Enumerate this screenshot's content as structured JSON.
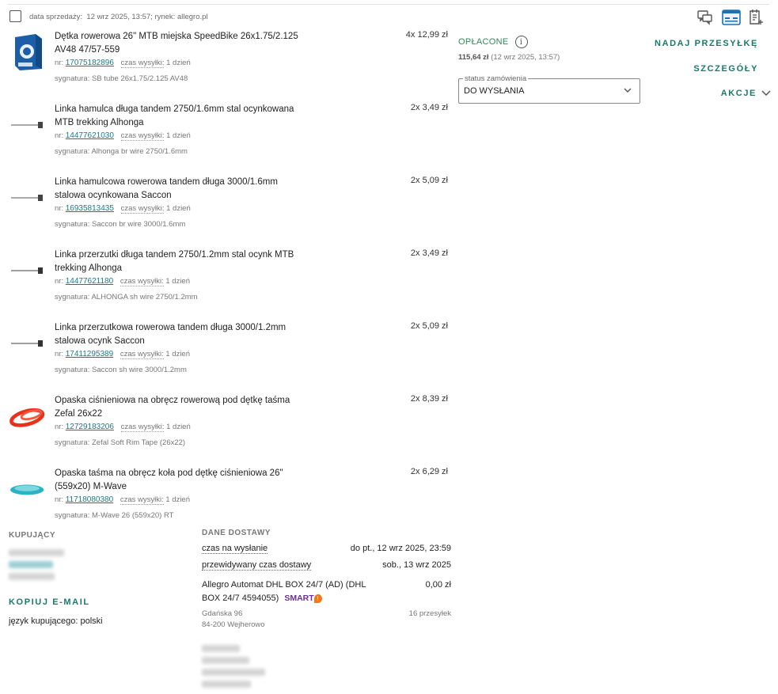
{
  "header": {
    "sale_date_label": "data sprzedaży:",
    "sale_date_value": "12 wrz 2025, 13:57; rynek: allegro.pl",
    "icons": [
      "chat-icon",
      "invoice-icon",
      "notes-icon"
    ]
  },
  "items": [
    {
      "name": "Dętka rowerowa 26\" MTB miejska SpeedBike 26x1.75/2.125 AV48 47/57-559",
      "price": "4x 12,99 zł",
      "nr_label": "nr:",
      "nr": "17075182896",
      "ship_label": "czas wysyłki:",
      "ship_value": "1 dzień",
      "sig": "sygnatura: SB tube 26x1.75/2.125 AV48",
      "thumb": "box-blue"
    },
    {
      "name": "Linka hamulca długa tandem 2750/1.6mm stal ocynkowana MTB trekking Alhonga",
      "price": "2x 3,49 zł",
      "nr_label": "nr:",
      "nr": "14477621030",
      "ship_label": "czas wysyłki:",
      "ship_value": "1 dzień",
      "sig": "sygnatura: Alhonga br wire 2750/1.6mm",
      "thumb": "cable"
    },
    {
      "name": "Linka hamulcowa rowerowa tandem długa 3000/1.6mm stalowa ocynkowana Saccon",
      "price": "2x 5,09 zł",
      "nr_label": "nr:",
      "nr": "16935813435",
      "ship_label": "czas wysyłki:",
      "ship_value": "1 dzień",
      "sig": "sygnatura: Saccon br wire 3000/1.6mm",
      "thumb": "cable"
    },
    {
      "name": "Linka przerzutki długa tandem 2750/1.2mm stal ocynk MTB trekking Alhonga",
      "price": "2x 3,49 zł",
      "nr_label": "nr:",
      "nr": "14477621180",
      "ship_label": "czas wysyłki:",
      "ship_value": "1 dzień",
      "sig": "sygnatura: ALHONGA sh wire 2750/1.2mm",
      "thumb": "cable"
    },
    {
      "name": "Linka przerzutkowa rowerowa tandem długa 3000/1.2mm stalowa ocynk Saccon",
      "price": "2x 5,09 zł",
      "nr_label": "nr:",
      "nr": "17411295389",
      "ship_label": "czas wysyłki:",
      "ship_value": "1 dzień",
      "sig": "sygnatura: Saccon sh wire 3000/1.2mm",
      "thumb": "cable"
    },
    {
      "name": "Opaska ciśnieniowa na obręcz rowerową pod dętkę taśma Zefal 26x22",
      "price": "2x 8,39 zł",
      "nr_label": "nr:",
      "nr": "12729183206",
      "ship_label": "czas wysyłki:",
      "ship_value": "1 dzień",
      "sig": "sygnatura: Zefal Soft Rim Tape (26x22)",
      "thumb": "tape-red"
    },
    {
      "name": "Opaska taśma na obręcz koła pod dętkę ciśnieniowa 26\" (559x20) M-Wave",
      "price": "2x 6,29 zł",
      "nr_label": "nr:",
      "nr": "11718080380",
      "ship_label": "czas wysyłki:",
      "ship_value": "1 dzień",
      "sig": "sygnatura: M-Wave 26 (559x20) RT",
      "thumb": "tape-teal"
    }
  ],
  "payment": {
    "status": "OPŁACONE",
    "amount": "115,64 zł",
    "date": "(12 wrz 2025, 13:57)"
  },
  "order_status": {
    "label": "status zamówienia",
    "value": "DO WYSŁANIA"
  },
  "actions": {
    "ship": "NADAJ PRZESYŁKĘ",
    "details": "SZCZEGÓŁY",
    "more": "AKCJE"
  },
  "buyer": {
    "title": "KUPUJĄCY",
    "copy_email": "KOPIUJ E-MAIL",
    "language": "język kupującego: polski"
  },
  "delivery": {
    "title": "DANE DOSTAWY",
    "rows": [
      {
        "key": "czas na wysłanie",
        "value": "do pt., 12 wrz 2025, 23:59"
      },
      {
        "key": "przewidywany czas dostawy",
        "value": "sob., 13 wrz 2025"
      }
    ],
    "method": "Allegro Automat DHL BOX 24/7 (AD) (DHL BOX 24/7 4594055)",
    "smart_label": "SMART",
    "method_price": "0,00 zł",
    "street": "Gdańska 96",
    "city": "84-200 Wejherowo",
    "packages": "16 przesyłek"
  },
  "colors": {
    "accent": "#1a7a6a",
    "paid": "#2e8b57",
    "link": "#1a7a8a",
    "smart": "#6b2fa0"
  }
}
